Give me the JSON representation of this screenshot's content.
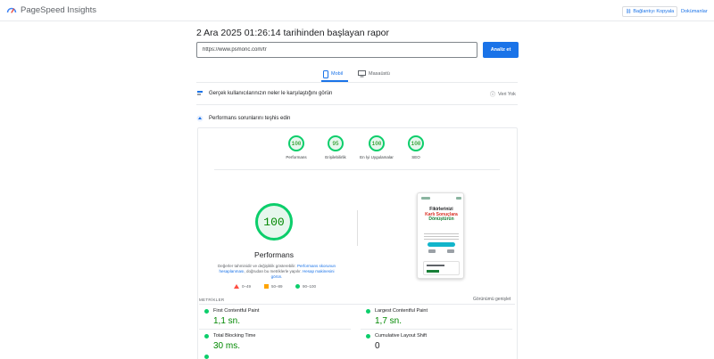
{
  "header": {
    "app_name": "PageSpeed Insights",
    "copy_link_label": "Bağlantıyı Kopyala",
    "docs_label": "Dokümanlar"
  },
  "report": {
    "title": "2 Ara 2025 01:26:14 tarihinden başlayan rapor",
    "url_value": "https://www.psmonc.com/tr",
    "analyze_label": "Analiz et"
  },
  "tabs": [
    {
      "label": "Mobil",
      "active": true
    },
    {
      "label": "Masaüstü",
      "active": false
    }
  ],
  "sections": {
    "field_data_label": "Gerçek kullanıcılarınızın neler le karşılaştığını görün",
    "no_data_label": "Veri Yok",
    "diagnose_label": "Performans sorunlarını teşhis edin"
  },
  "categories": [
    {
      "score": "100",
      "label": "Performans"
    },
    {
      "score": "95",
      "label": "Erişilebilirlik"
    },
    {
      "score": "100",
      "label": "En İyi Uygulamalar"
    },
    {
      "score": "100",
      "label": "SEO"
    }
  ],
  "performance": {
    "score": "100",
    "label": "Performans",
    "desc_prefix": "Değerler tahminidir ve değişiklik gösterebilir.",
    "desc_link1": "Performans skorunun hesaplanması",
    "desc_middle": ", doğrudan bu metriklerle yapılır.",
    "desc_link2": "Hesap makinesini görün."
  },
  "legend": [
    {
      "range": "0–49",
      "color": "#ff4e42"
    },
    {
      "range": "50–89",
      "color": "#ffa400"
    },
    {
      "range": "90–100",
      "color": "#0cce6b"
    }
  ],
  "screenshot": {
    "title_line1": "Fikirlerinizi",
    "title_line2": "Karlı Sonuçlara",
    "title_line3": "Dönüştürün"
  },
  "metrics": {
    "section_label": "METRİKLER",
    "expand_label": "Görünümü genişlet",
    "items": [
      {
        "name": "First Contentful Paint",
        "value": "1,1 sn."
      },
      {
        "name": "Largest Contentful Paint",
        "value": "1,7 sn."
      },
      {
        "name": "Total Blocking Time",
        "value": "30 ms."
      },
      {
        "name": "Cumulative Layout Shift",
        "value": "0"
      }
    ]
  },
  "colors": {
    "accent": "#1a73e8",
    "pass": "#0cce6b",
    "pass_text": "#008800"
  }
}
